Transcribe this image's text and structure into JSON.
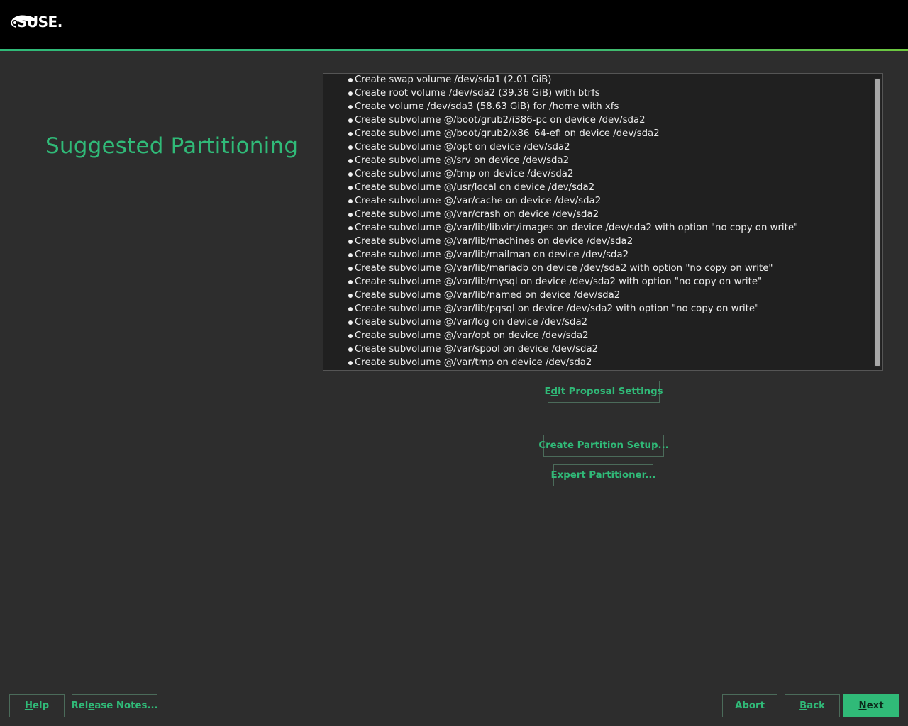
{
  "header": {
    "logo_text": "SUSE."
  },
  "page": {
    "title": "Suggested Partitioning"
  },
  "proposal": {
    "actions": [
      "Create swap volume /dev/sda1 (2.01 GiB)",
      "Create root volume /dev/sda2 (39.36 GiB) with btrfs",
      "Create volume /dev/sda3 (58.63 GiB) for /home with xfs",
      "Create subvolume @/boot/grub2/i386-pc on device /dev/sda2",
      "Create subvolume @/boot/grub2/x86_64-efi on device /dev/sda2",
      "Create subvolume @/opt on device /dev/sda2",
      "Create subvolume @/srv on device /dev/sda2",
      "Create subvolume @/tmp on device /dev/sda2",
      "Create subvolume @/usr/local on device /dev/sda2",
      "Create subvolume @/var/cache on device /dev/sda2",
      "Create subvolume @/var/crash on device /dev/sda2",
      "Create subvolume @/var/lib/libvirt/images on device /dev/sda2 with option \"no copy on write\"",
      "Create subvolume @/var/lib/machines on device /dev/sda2",
      "Create subvolume @/var/lib/mailman on device /dev/sda2",
      "Create subvolume @/var/lib/mariadb on device /dev/sda2 with option \"no copy on write\"",
      "Create subvolume @/var/lib/mysql on device /dev/sda2 with option \"no copy on write\"",
      "Create subvolume @/var/lib/named on device /dev/sda2",
      "Create subvolume @/var/lib/pgsql on device /dev/sda2 with option \"no copy on write\"",
      "Create subvolume @/var/log on device /dev/sda2",
      "Create subvolume @/var/opt on device /dev/sda2",
      "Create subvolume @/var/spool on device /dev/sda2",
      "Create subvolume @/var/tmp on device /dev/sda2"
    ]
  },
  "buttons": {
    "edit_proposal": {
      "pre": "E",
      "key": "d",
      "post": "it Proposal Settings"
    },
    "create_setup": {
      "pre": "",
      "key": "C",
      "post": "reate Partition Setup..."
    },
    "expert": {
      "pre": "",
      "key": "E",
      "post": "xpert Partitioner..."
    },
    "help": {
      "pre": "",
      "key": "H",
      "post": "elp"
    },
    "release_notes": {
      "pre": "Rel",
      "key": "e",
      "post": "ase Notes..."
    },
    "abort": {
      "pre": "Abort",
      "key": "",
      "post": ""
    },
    "back": {
      "pre": "",
      "key": "B",
      "post": "ack"
    },
    "next": {
      "pre": "",
      "key": "N",
      "post": "ext"
    }
  },
  "colors": {
    "accent": "#30ba78",
    "background": "#2d2d2d"
  }
}
